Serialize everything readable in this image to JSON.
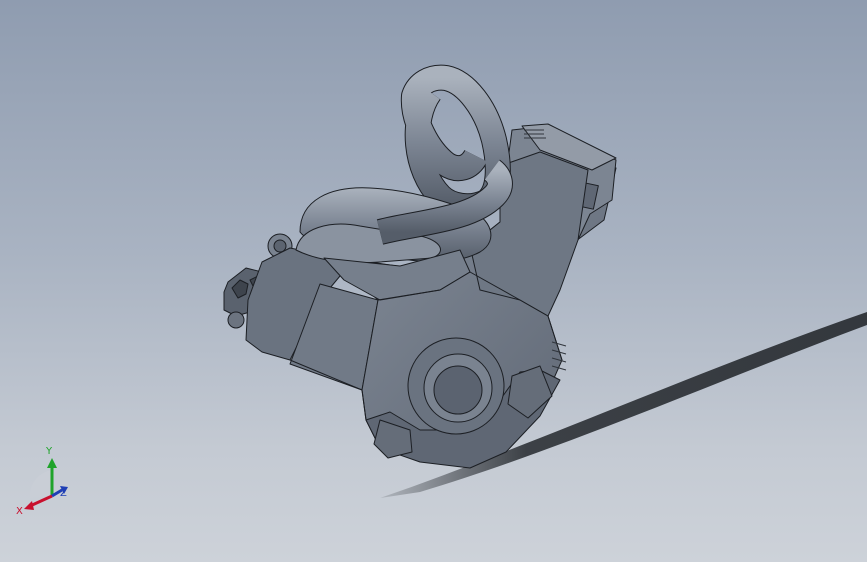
{
  "triad": {
    "x_label": "X",
    "y_label": "Y",
    "z_label": "Z",
    "colors": {
      "x": "#c8102e",
      "y": "#1fa32a",
      "z": "#1f3fb5"
    }
  },
  "colors": {
    "background_top": "#8f9cb0",
    "background_bottom": "#cdd2d9",
    "body": "#6f7886",
    "body_light": "#8c95a2",
    "body_dark": "#4e5663",
    "edge": "#1c1f24",
    "shadow": "#2d3136"
  }
}
